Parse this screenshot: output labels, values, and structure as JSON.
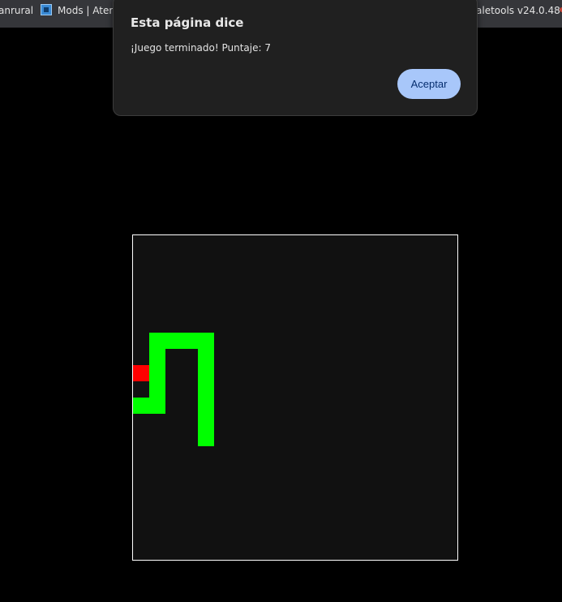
{
  "bookmarks_bar": {
    "items": [
      {
        "label": "anrural",
        "icon": null
      },
      {
        "label": "Mods | Atern",
        "icon": "aternos-icon"
      },
      {
        "label": "aletools v24.0.48",
        "icon": null
      }
    ]
  },
  "dialog": {
    "title": "Esta página dice",
    "message": "¡Juego terminado! Puntaje: 7",
    "accept_label": "Aceptar"
  },
  "game": {
    "grid_size": 20,
    "cell_size_label": "20 cells per side",
    "colors": {
      "background": "#111111",
      "border": "#ffffff",
      "snake": "#00ff00",
      "food": "#ff0000"
    },
    "snake": [
      {
        "col": 4,
        "row": 12
      },
      {
        "col": 4,
        "row": 11
      },
      {
        "col": 4,
        "row": 10
      },
      {
        "col": 4,
        "row": 9
      },
      {
        "col": 4,
        "row": 8
      },
      {
        "col": 4,
        "row": 7
      },
      {
        "col": 4,
        "row": 6
      },
      {
        "col": 3,
        "row": 6
      },
      {
        "col": 2,
        "row": 6
      },
      {
        "col": 1,
        "row": 6
      },
      {
        "col": 1,
        "row": 7
      },
      {
        "col": 1,
        "row": 8
      },
      {
        "col": 1,
        "row": 9
      },
      {
        "col": 1,
        "row": 10
      },
      {
        "col": 0,
        "row": 10
      }
    ],
    "food": {
      "col": 0,
      "row": 8
    }
  }
}
